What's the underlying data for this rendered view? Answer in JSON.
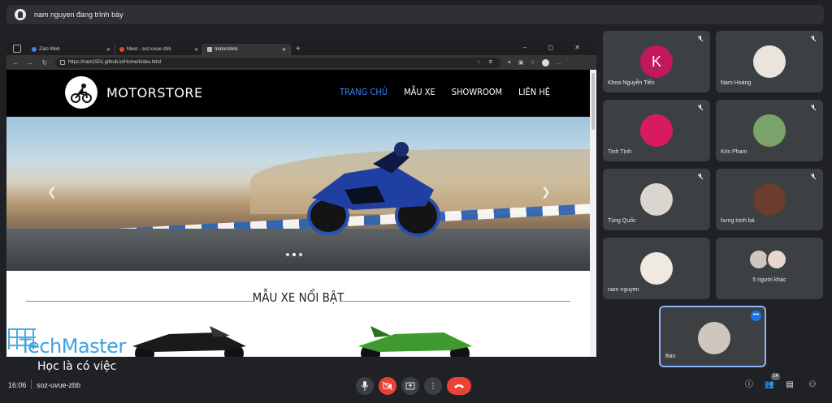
{
  "presenter": {
    "text": "nam nguyen đang trình bày"
  },
  "browser": {
    "tabs": [
      {
        "label": "Zalo Web",
        "active": false
      },
      {
        "label": "Meet - soz-uvue-zbb",
        "active": false
      },
      {
        "label": "motorstore",
        "active": true
      }
    ],
    "url": "https://nam1501.github.io/Home/index.html"
  },
  "site": {
    "brand": "MOTORSTORE",
    "nav": [
      "TRANG CHỦ",
      "MẪU XE",
      "SHOWROOM",
      "LIÊN HỆ"
    ],
    "active_nav": "TRANG CHỦ",
    "featured_heading": "MẪU XE NỔI BẬT",
    "hero_prev": "❮",
    "hero_next": "❯"
  },
  "watermark": {
    "brand": "TechMaster",
    "slogan": "Học là có việc"
  },
  "participants": [
    {
      "name": "Khoa Nguyễn Tiến",
      "initial": "K",
      "avatar_color": "#c2185b"
    },
    {
      "name": "Nam Hoàng",
      "initial": "",
      "avatar_color": "#e9e4dc"
    },
    {
      "name": "Tịnh Tịnh",
      "initial": "",
      "avatar_color": "#d81b60"
    },
    {
      "name": "Kris Pham",
      "initial": "",
      "avatar_color": "#7aa36a"
    },
    {
      "name": "Tùng Quốc",
      "initial": "",
      "avatar_color": "#d9d6d0"
    },
    {
      "name": "hưng trịnh bá",
      "initial": "",
      "avatar_color": "#6b3d2c"
    },
    {
      "name": "nam nguyen",
      "initial": "",
      "avatar_color": "#efe9e1"
    },
    {
      "name": "5 người khác",
      "initial": "",
      "avatar_color": "#cfc7bd"
    },
    {
      "name": "Bạn",
      "initial": "",
      "avatar_color": "#6f87a6"
    }
  ],
  "meeting": {
    "time": "16:06",
    "code": "soz-uvue-zbb",
    "people_count": "14"
  },
  "colors": {
    "background": "#202124",
    "tile": "#3c4043",
    "accent": "#1a73e8",
    "danger": "#ea4335",
    "nav_active": "#3b82f6"
  }
}
